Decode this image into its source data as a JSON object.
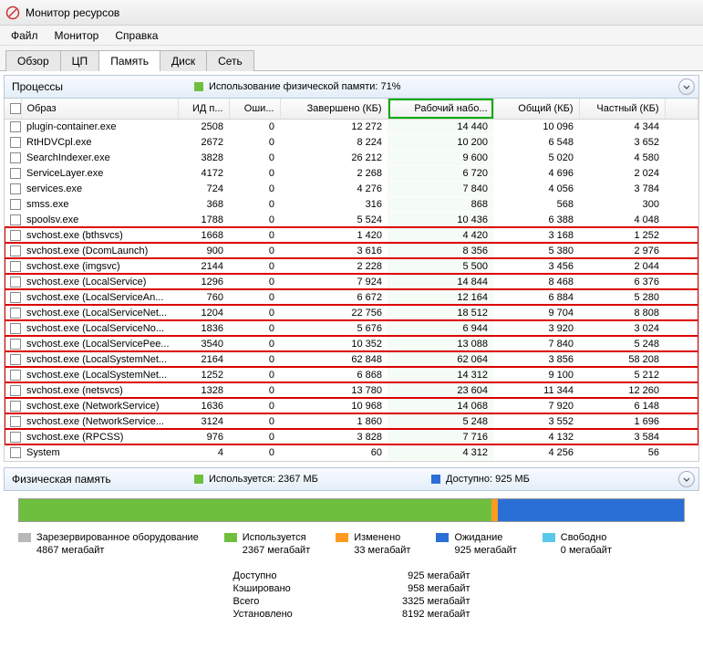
{
  "window": {
    "title": "Монитор ресурсов"
  },
  "menu": {
    "file": "Файл",
    "monitor": "Монитор",
    "help": "Справка"
  },
  "tabs": {
    "overview": "Обзор",
    "cpu": "ЦП",
    "memory": "Память",
    "disk": "Диск",
    "network": "Сеть"
  },
  "sections": {
    "processes": {
      "title": "Процессы",
      "subtitle": "Использование физической памяти: 71%"
    },
    "physmem": {
      "title": "Физическая память",
      "used_label": "Используется: 2367 МБ",
      "avail_label": "Доступно: 925 МБ"
    }
  },
  "columns": {
    "image": "Образ",
    "pid": "ИД п...",
    "faults": "Оши...",
    "commit": "Завершено (КБ)",
    "workingset": "Рабочий набо...",
    "shared": "Общий (КБ)",
    "private": "Частный (КБ)"
  },
  "rows": [
    {
      "image": "plugin-container.exe",
      "pid": "2508",
      "faults": "0",
      "commit": "12 272",
      "ws": "14 440",
      "shared": "10 096",
      "priv": "4 344",
      "hl": false
    },
    {
      "image": "RtHDVCpl.exe",
      "pid": "2672",
      "faults": "0",
      "commit": "8 224",
      "ws": "10 200",
      "shared": "6 548",
      "priv": "3 652",
      "hl": false
    },
    {
      "image": "SearchIndexer.exe",
      "pid": "3828",
      "faults": "0",
      "commit": "26 212",
      "ws": "9 600",
      "shared": "5 020",
      "priv": "4 580",
      "hl": false
    },
    {
      "image": "ServiceLayer.exe",
      "pid": "4172",
      "faults": "0",
      "commit": "2 268",
      "ws": "6 720",
      "shared": "4 696",
      "priv": "2 024",
      "hl": false
    },
    {
      "image": "services.exe",
      "pid": "724",
      "faults": "0",
      "commit": "4 276",
      "ws": "7 840",
      "shared": "4 056",
      "priv": "3 784",
      "hl": false
    },
    {
      "image": "smss.exe",
      "pid": "368",
      "faults": "0",
      "commit": "316",
      "ws": "868",
      "shared": "568",
      "priv": "300",
      "hl": false
    },
    {
      "image": "spoolsv.exe",
      "pid": "1788",
      "faults": "0",
      "commit": "5 524",
      "ws": "10 436",
      "shared": "6 388",
      "priv": "4 048",
      "hl": false
    },
    {
      "image": "svchost.exe (bthsvcs)",
      "pid": "1668",
      "faults": "0",
      "commit": "1 420",
      "ws": "4 420",
      "shared": "3 168",
      "priv": "1 252",
      "hl": true
    },
    {
      "image": "svchost.exe (DcomLaunch)",
      "pid": "900",
      "faults": "0",
      "commit": "3 616",
      "ws": "8 356",
      "shared": "5 380",
      "priv": "2 976",
      "hl": true
    },
    {
      "image": "svchost.exe (imgsvc)",
      "pid": "2144",
      "faults": "0",
      "commit": "2 228",
      "ws": "5 500",
      "shared": "3 456",
      "priv": "2 044",
      "hl": true
    },
    {
      "image": "svchost.exe (LocalService)",
      "pid": "1296",
      "faults": "0",
      "commit": "7 924",
      "ws": "14 844",
      "shared": "8 468",
      "priv": "6 376",
      "hl": true
    },
    {
      "image": "svchost.exe (LocalServiceAn...",
      "pid": "760",
      "faults": "0",
      "commit": "6 672",
      "ws": "12 164",
      "shared": "6 884",
      "priv": "5 280",
      "hl": true
    },
    {
      "image": "svchost.exe (LocalServiceNet...",
      "pid": "1204",
      "faults": "0",
      "commit": "22 756",
      "ws": "18 512",
      "shared": "9 704",
      "priv": "8 808",
      "hl": true
    },
    {
      "image": "svchost.exe (LocalServiceNo...",
      "pid": "1836",
      "faults": "0",
      "commit": "5 676",
      "ws": "6 944",
      "shared": "3 920",
      "priv": "3 024",
      "hl": true
    },
    {
      "image": "svchost.exe (LocalServicePee...",
      "pid": "3540",
      "faults": "0",
      "commit": "10 352",
      "ws": "13 088",
      "shared": "7 840",
      "priv": "5 248",
      "hl": true
    },
    {
      "image": "svchost.exe (LocalSystemNet...",
      "pid": "2164",
      "faults": "0",
      "commit": "62 848",
      "ws": "62 064",
      "shared": "3 856",
      "priv": "58 208",
      "hl": true
    },
    {
      "image": "svchost.exe (LocalSystemNet...",
      "pid": "1252",
      "faults": "0",
      "commit": "6 868",
      "ws": "14 312",
      "shared": "9 100",
      "priv": "5 212",
      "hl": true
    },
    {
      "image": "svchost.exe (netsvcs)",
      "pid": "1328",
      "faults": "0",
      "commit": "13 780",
      "ws": "23 604",
      "shared": "11 344",
      "priv": "12 260",
      "hl": true
    },
    {
      "image": "svchost.exe (NetworkService)",
      "pid": "1636",
      "faults": "0",
      "commit": "10 968",
      "ws": "14 068",
      "shared": "7 920",
      "priv": "6 148",
      "hl": true
    },
    {
      "image": "svchost.exe (NetworkService...",
      "pid": "3124",
      "faults": "0",
      "commit": "1 860",
      "ws": "5 248",
      "shared": "3 552",
      "priv": "1 696",
      "hl": true
    },
    {
      "image": "svchost.exe (RPCSS)",
      "pid": "976",
      "faults": "0",
      "commit": "3 828",
      "ws": "7 716",
      "shared": "4 132",
      "priv": "3 584",
      "hl": true
    },
    {
      "image": "System",
      "pid": "4",
      "faults": "0",
      "commit": "60",
      "ws": "4 312",
      "shared": "4 256",
      "priv": "56",
      "hl": false
    }
  ],
  "legend": {
    "reserved": {
      "label": "Зарезервированное оборудование",
      "value": "4867 мегабайт",
      "color": "#b8b8b8"
    },
    "used": {
      "label": "Используется",
      "value": "2367 мегабайт",
      "color": "#6fbf3f"
    },
    "modified": {
      "label": "Изменено",
      "value": "33 мегабайт",
      "color": "#ff9a1f"
    },
    "standby": {
      "label": "Ожидание",
      "value": "925 мегабайт",
      "color": "#2a6fd6"
    },
    "free": {
      "label": "Свободно",
      "value": "0 мегабайт",
      "color": "#58c8e8"
    }
  },
  "membar_segments": [
    {
      "color": "#6fbf3f",
      "pct": 71
    },
    {
      "color": "#ff9a1f",
      "pct": 1
    },
    {
      "color": "#2a6fd6",
      "pct": 28
    },
    {
      "color": "#58c8e8",
      "pct": 0
    }
  ],
  "summary": {
    "available": {
      "label": "Доступно",
      "value": "925 мегабайт"
    },
    "cached": {
      "label": "Кэшировано",
      "value": "958 мегабайт"
    },
    "total": {
      "label": "Всего",
      "value": "3325 мегабайт"
    },
    "installed": {
      "label": "Установлено",
      "value": "8192 мегабайт"
    }
  }
}
